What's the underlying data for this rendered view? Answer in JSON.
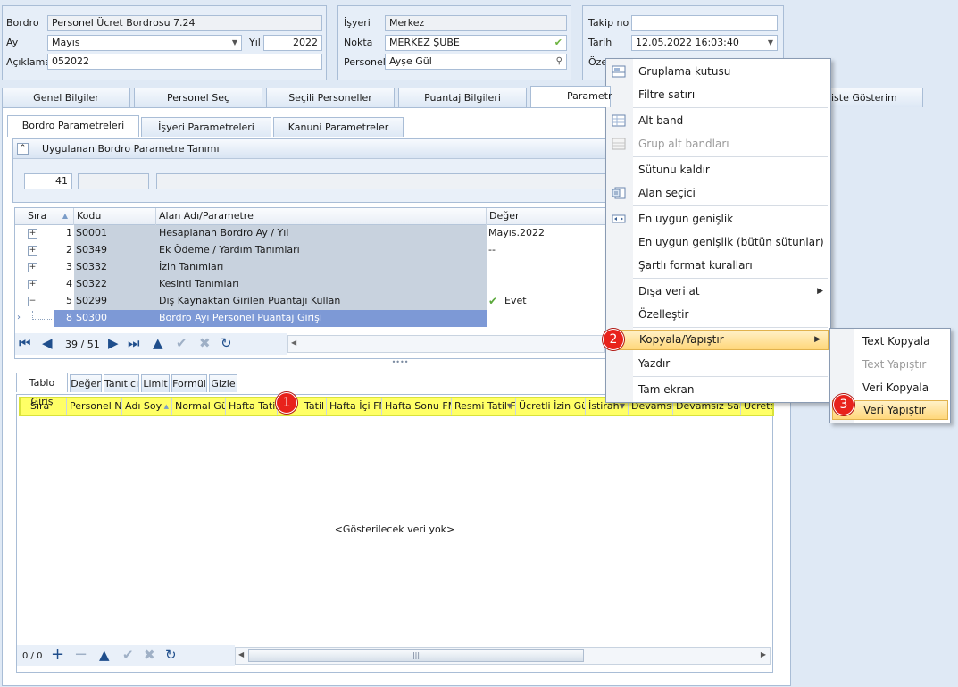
{
  "bordro": {
    "label": "Bordro",
    "value": "Personel Ücret Bordrosu 7.24",
    "ay_label": "Ay",
    "ay_value": "Mayıs",
    "yil_label": "Yıl",
    "yil_value": "2022",
    "aciklama_label": "Açıklama",
    "aciklama_value": "052022"
  },
  "isyeri": {
    "label": "İşyeri",
    "value": "Merkez",
    "nokta_label": "Nokta",
    "nokta_value": "MERKEZ ŞUBE",
    "personel_label": "Personel",
    "personel_value": "Ayşe Gül"
  },
  "takip": {
    "takip_label": "Takip no",
    "takip_value": "",
    "tarih_label": "Tarih",
    "tarih_value": "12.05.2022 16:03:40",
    "ozel_label": "Özel"
  },
  "main_tabs": [
    {
      "label": "Genel Bilgiler"
    },
    {
      "label": "Personel Seç"
    },
    {
      "label": "Seçili Personeller"
    },
    {
      "label": "Puantaj Bilgileri"
    },
    {
      "label": "Parametr"
    },
    {
      "label": "iste Gösterim"
    }
  ],
  "sub_tabs": [
    {
      "label": "Bordro Parametreleri"
    },
    {
      "label": "İşyeri Parametreleri"
    },
    {
      "label": "Kanuni Parametreler"
    }
  ],
  "group_panel": {
    "title": "Uygulanan Bordro Parametre Tanımı",
    "field1": "41"
  },
  "param_grid": {
    "headers": [
      "Sıra",
      "Kodu",
      "Alan Adı/Parametre",
      "Değer"
    ],
    "rows": [
      {
        "sira": "1",
        "kodu": "S0001",
        "alan": "Hesaplanan Bordro Ay / Yıl",
        "deger": "Mayıs.2022",
        "exp": "+"
      },
      {
        "sira": "2",
        "kodu": "S0349",
        "alan": "Ek Ödeme / Yardım Tanımları",
        "deger": "--",
        "exp": "+"
      },
      {
        "sira": "3",
        "kodu": "S0332",
        "alan": "İzin Tanımları",
        "deger": "",
        "exp": "+"
      },
      {
        "sira": "4",
        "kodu": "S0322",
        "alan": "Kesinti Tanımları",
        "deger": "",
        "exp": "+"
      },
      {
        "sira": "5",
        "kodu": "S0299",
        "alan": "Dış Kaynaktan Girilen Puantajı Kullan",
        "deger": "Evet",
        "exp": "−"
      },
      {
        "sira": "8",
        "kodu": "S0300",
        "alan": "Bordro Ayı Personel Puantaj Girişi",
        "deger": "",
        "exp": ""
      }
    ],
    "nav_position": "39 / 51"
  },
  "lower_tabs": [
    {
      "label": "Tablo Giriş"
    },
    {
      "label": "Değer"
    },
    {
      "label": "Tanıtıcı"
    },
    {
      "label": "Limit"
    },
    {
      "label": "Formül"
    },
    {
      "label": "Gizle"
    }
  ],
  "data_grid": {
    "headers": [
      "Sıra",
      "Personel No",
      "Adı Soy",
      "Normal Gün",
      "Hafta Tatili",
      "Tatil",
      "Hafta İçi FM",
      "Hafta Sonu FM",
      "Resmi Tatil F",
      "Ücretli İzin Gün",
      "İstirah",
      "Devamsız",
      "Devamsız Saat",
      "Ücretsiz"
    ],
    "empty_text": "<Gösterilecek veri yok>",
    "nav_position": "0 / 0"
  },
  "context_menu": {
    "items": [
      {
        "label": "Gruplama kutusu",
        "icon": "group-box-icon"
      },
      {
        "label": "Filtre satırı",
        "icon": ""
      },
      {
        "label": "Alt band",
        "icon": "footer-band-icon"
      },
      {
        "label": "Grup alt bandları",
        "icon": "group-footer-icon"
      },
      {
        "label": "Sütunu kaldır",
        "icon": ""
      },
      {
        "label": "Alan seçici",
        "icon": "field-chooser-icon"
      },
      {
        "label": "En uygun genişlik",
        "icon": "best-fit-icon"
      },
      {
        "label": "En uygun genişlik (bütün sütunlar)",
        "icon": ""
      },
      {
        "label": "Şartlı format kuralları",
        "icon": ""
      },
      {
        "label": "Dışa veri at",
        "icon": ""
      },
      {
        "label": "Özelleştir",
        "icon": ""
      },
      {
        "label": "Kopyala/Yapıştır",
        "icon": ""
      },
      {
        "label": "Yazdır",
        "icon": ""
      },
      {
        "label": "Tam ekran",
        "icon": ""
      }
    ]
  },
  "submenu": {
    "items": [
      {
        "label": "Text Kopyala"
      },
      {
        "label": "Text Yapıştır"
      },
      {
        "label": "Veri Kopyala"
      },
      {
        "label": "Veri Yapıştır"
      }
    ]
  },
  "badges": [
    "1",
    "2",
    "3"
  ],
  "colors": {
    "highlight": "#ffff66",
    "badge": "#e8221b",
    "selected_row": "#7d99d6"
  }
}
